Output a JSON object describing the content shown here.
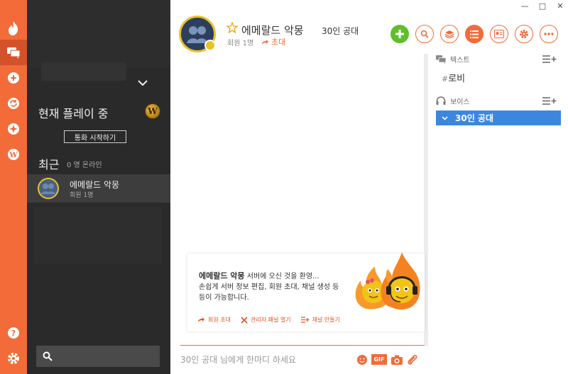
{
  "window": {
    "minimize": "—",
    "maximize": "□",
    "close": "✕"
  },
  "sidebar": {
    "playing_title": "현재 플레이 중",
    "game_badge": "W",
    "call_button": "통화 시작하기",
    "recent_title": "최근",
    "recent_online": "0 명 온라인",
    "recent_items": [
      {
        "name": "에메랄드 악몽",
        "members": "회원 1명"
      }
    ],
    "search_icon": "search-icon"
  },
  "header": {
    "server_name": "에메랄드 악몽",
    "channel_name": "30인 공대",
    "member_count": "회원 1명",
    "invite_label": "초대",
    "toolbar": [
      "add-icon",
      "search-icon",
      "layers-icon",
      "list-icon",
      "member-card-icon",
      "gear-icon",
      "more-icon"
    ]
  },
  "welcome": {
    "server_name": "에메랄드 악몽",
    "line1_rest": " 서버에 오신 것을 환영...",
    "line2": "손쉽게 서버 정보 편집, 회원 초대, 채널 생성 등",
    "line3": "등이 가능합니다.",
    "actions": {
      "invite": "회원 초대",
      "admin": "관리자 패널 열기",
      "create_channel": "채널 만들기"
    }
  },
  "message_input": {
    "placeholder": "30인 공대 님에게 한마디 하세요"
  },
  "channels": {
    "text_category": "텍스트",
    "text_channel": "로비",
    "voice_category": "보이스",
    "voice_channel": "30인 공대"
  },
  "colors": {
    "accent": "#f26b38",
    "rail": "#f26b38",
    "sidebar": "#2a2a2a",
    "selected_voice": "#3b87e0",
    "add_green": "#5fbf2a"
  }
}
